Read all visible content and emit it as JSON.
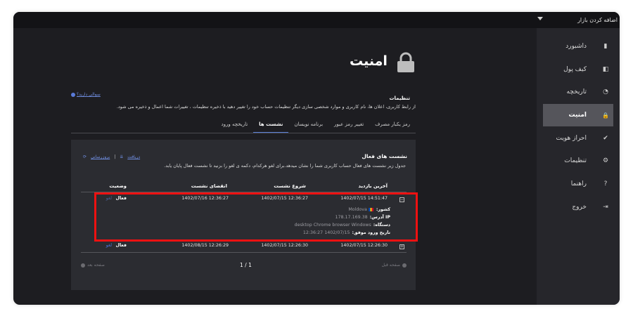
{
  "sidebar": {
    "market_select": "اضافه کردن بازار",
    "items": [
      {
        "label": "داشبورد",
        "icon": "bar-chart-icon",
        "glyph": "▮"
      },
      {
        "label": "کیف پول",
        "icon": "wallet-icon",
        "glyph": "◧"
      },
      {
        "label": "تاریخچه",
        "icon": "clock-icon",
        "glyph": "◔"
      },
      {
        "label": "امنیت",
        "icon": "lock-icon",
        "glyph": "🔒"
      },
      {
        "label": "احراز هویت",
        "icon": "check-circle-icon",
        "glyph": "✔"
      },
      {
        "label": "تنظیمات",
        "icon": "gear-icon",
        "glyph": "⚙"
      },
      {
        "label": "راهنما",
        "icon": "help-icon",
        "glyph": "?"
      },
      {
        "label": "خروج",
        "icon": "logout-icon",
        "glyph": "⇥"
      }
    ],
    "active_index": 3
  },
  "page": {
    "title": "امنیت",
    "help_link": "سوالی دارید؟",
    "section_label": "تنظیمات",
    "section_desc": "از رابط کاربری، اعلان ها، نام کاربری و موارد شخصی سازی دیگر تنظیمات حساب خود را تغییر دهید با ذخیره تنظیمات ، تغییرات شما اعمال و ذخیره می شود."
  },
  "tabs": [
    {
      "label": "رمز یکبار مصرف",
      "active": false
    },
    {
      "label": "تغییر رمز عبور",
      "active": false
    },
    {
      "label": "برنامه نویسان",
      "active": false
    },
    {
      "label": "نشست ها",
      "active": true
    },
    {
      "label": "تاریخچه ورود",
      "active": false
    }
  ],
  "sessions": {
    "title": "نشست های فعال",
    "description": "جدول زیر نشست های فعال حساب کاربری شما را نشان میدهد.برای لغو هرکدام، دکمه ی لغو را بزنید تا نشست فعال پایان یابد.",
    "action_refresh": "بروزرسانی",
    "action_download": "دریافت",
    "columns": {
      "last_visit": "آخرین بازدید",
      "session_start": "شروع نشست",
      "session_expire": "انقضای نشست",
      "status": "وضعیت"
    },
    "rows": [
      {
        "last_visit": "1402/07/15 14:51:47",
        "session_start": "1402/07/15 12:36:27",
        "session_expire": "1402/07/16 12:36:27",
        "status": "فعال",
        "action": "لغو",
        "expander": "−"
      },
      {
        "last_visit": "1402/07/15 12:26:30",
        "session_start": "1402/07/15 12:26:30",
        "session_expire": "1402/08/15 12:26:29",
        "status": "فعال",
        "action": "لغو",
        "expander": "+"
      }
    ],
    "detail": {
      "country_label": "کشور:",
      "country_value": "Moldova",
      "ip_label": "IP آدرس:",
      "ip_value": "178.17.169.38",
      "device_label": "دستگاه:",
      "device_value": "desktop Chrome browser Windows",
      "login_label": "تاریخ ورود موفق:",
      "login_value": "1402/07/15 12:36:27"
    },
    "pager": {
      "prev": "صفحه قبل",
      "next": "صفحه بعد",
      "count": "1 / 1"
    }
  },
  "colors": {
    "accent": "#5b7fd6",
    "highlight": "#ee1111",
    "background": "#1d1d21",
    "sidebar": "#26262b"
  }
}
